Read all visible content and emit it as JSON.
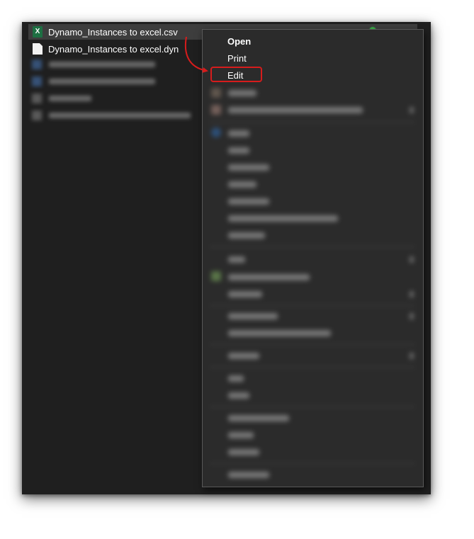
{
  "files": [
    {
      "name": "Dynamo_Instances to excel.csv",
      "icon": "excel-csv-icon",
      "selected": true
    },
    {
      "name": "Dynamo_Instances to excel.dyn",
      "icon": "document-icon",
      "selected": false
    }
  ],
  "context_menu": {
    "items": [
      {
        "label": "Open",
        "bold": true
      },
      {
        "label": "Print",
        "bold": false
      },
      {
        "label": "Edit",
        "bold": false,
        "highlighted": true
      }
    ]
  },
  "annotation": {
    "arrow_color": "#d71c1c",
    "highlight_color": "#d71c1c"
  }
}
